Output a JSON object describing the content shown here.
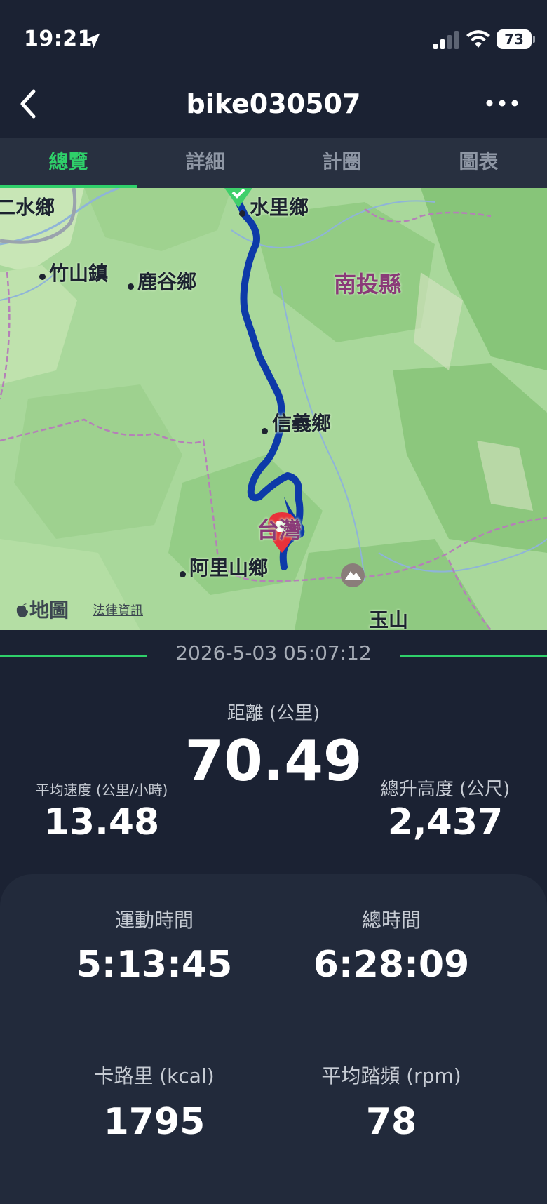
{
  "status_bar": {
    "time": "19:21",
    "battery": "73"
  },
  "nav": {
    "title": "bike030507"
  },
  "tabs": [
    {
      "label": "總覽",
      "active": true
    },
    {
      "label": "詳細",
      "active": false
    },
    {
      "label": "計圈",
      "active": false
    },
    {
      "label": "圖表",
      "active": false
    }
  ],
  "map": {
    "place_labels": [
      "水里鄉",
      "竹山鎮",
      "鹿谷鄉",
      "信義鄉",
      "阿里山鄉",
      "玉山",
      "二水鄉"
    ],
    "region_labels": [
      "南投縣",
      "台灣"
    ],
    "attribution": "地圖",
    "legal": "法律資訊",
    "route_color": "#0d3aa8",
    "start_color": "#3fcf6a",
    "end_color": "#e8323a"
  },
  "activity": {
    "date": "2026-5-03 05:07:12"
  },
  "summary": {
    "distance_label": "距離 (公里)",
    "distance_value": "70.49",
    "avg_speed_label": "平均速度 (公里/小時)",
    "avg_speed_value": "13.48",
    "ascent_label": "總升高度 (公尺)",
    "ascent_value": "2,437"
  },
  "details": {
    "moving_time_label": "運動時間",
    "moving_time_value": "5:13:45",
    "total_time_label": "總時間",
    "total_time_value": "6:28:09",
    "calories_label": "卡路里 (kcal)",
    "calories_value": "1795",
    "cadence_label": "平均踏頻 (rpm)",
    "cadence_value": "78"
  },
  "colors": {
    "background": "#1b2233",
    "accent": "#2fd06a",
    "tab_bar": "#283040",
    "card": "#222a3b"
  }
}
